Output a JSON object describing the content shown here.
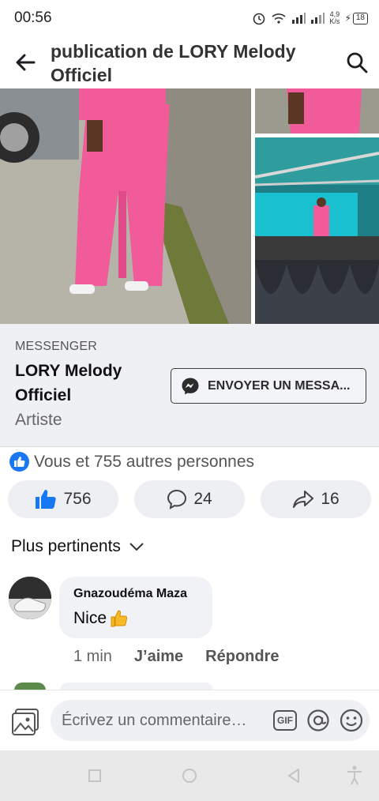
{
  "status": {
    "time": "00:56",
    "net_value": "4,9",
    "net_unit": "K/s",
    "battery": "18"
  },
  "header": {
    "title": "publication de LORY Melody Officiel"
  },
  "messenger": {
    "label": "MESSENGER",
    "name": "LORY Melody Officiel",
    "subtitle": "Artiste",
    "button_label": "ENVOYER UN MESSA..."
  },
  "reactions": {
    "summary": "Vous et 755 autres personnes",
    "likes": "756",
    "comments": "24",
    "shares": "16"
  },
  "sort": {
    "label": "Plus pertinents"
  },
  "comment": {
    "author": "Gnazoudéma Maza",
    "text": "Nice",
    "time": "1 min",
    "like_label": "J’aime",
    "reply_label": "Répondre"
  },
  "composer": {
    "placeholder": "Écrivez un commentaire…",
    "gif_label": "GIF"
  },
  "colors": {
    "accent": "#1877f2",
    "pink_outfit": "#f15b9a"
  }
}
